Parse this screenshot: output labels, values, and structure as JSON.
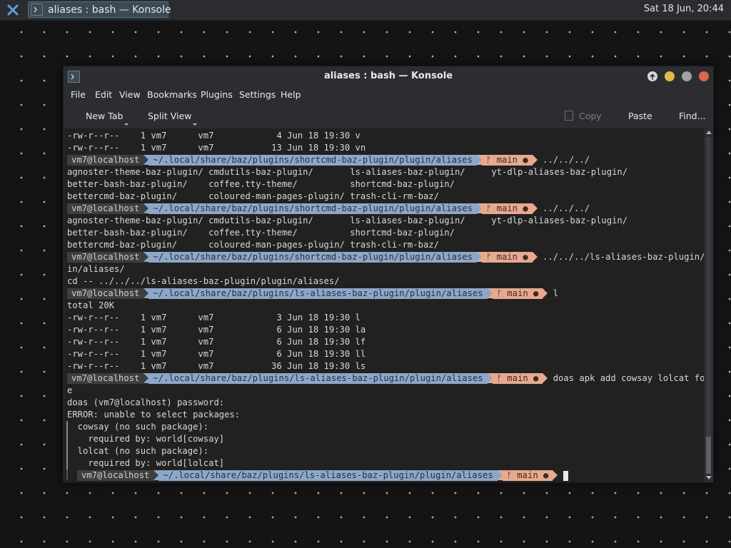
{
  "panel": {
    "task_title": "aliases : bash — Konsole",
    "clock": "Sat 18 Jun, 20:44"
  },
  "window": {
    "title": "aliases : bash — Konsole"
  },
  "menu": [
    "File",
    "Edit",
    "View",
    "Bookmarks",
    "Plugins",
    "Settings",
    "Help"
  ],
  "toolbar": {
    "new_tab": "New Tab",
    "split_view": "Split View",
    "copy": "Copy",
    "paste": "Paste",
    "find": "Find..."
  },
  "prompt": {
    "host": "vm7@localhost",
    "path_shortcmd": "~/.local/share/baz/plugins/shortcmd-baz-plugin/plugin/aliases",
    "path_lsaliases": "~/.local/share/baz/plugins/ls-aliases-baz-plugin/plugin/aliases",
    "git": "ᚠ main ●"
  },
  "terminal": {
    "l0": "-rw-r--r--    1 vm7      vm7            4 Jun 18 19:30 v",
    "l1": "-rw-r--r--    1 vm7      vm7           13 Jun 18 19:30 vn",
    "c2": "../../../",
    "l3": "agnoster-theme-baz-plugin/ cmdutils-baz-plugin/       ls-aliases-baz-plugin/     yt-dlp-aliases-baz-plugin/",
    "l4": "better-bash-baz-plugin/    coffee.tty-theme/          shortcmd-baz-plugin/",
    "l5": "bettercmd-baz-plugin/      coloured-man-pages-plugin/ trash-cli-rm-baz/",
    "c6": "../../../",
    "l7": "agnoster-theme-baz-plugin/ cmdutils-baz-plugin/       ls-aliases-baz-plugin/     yt-dlp-aliases-baz-plugin/",
    "l8": "better-bash-baz-plugin/    coffee.tty-theme/          shortcmd-baz-plugin/",
    "l9": "bettercmd-baz-plugin/      coloured-man-pages-plugin/ trash-cli-rm-baz/",
    "c10": "../../../ls-aliases-baz-plugin/plug",
    "l11": "in/aliases/",
    "l12": "cd -- ../../../ls-aliases-baz-plugin/plugin/aliases/",
    "c13": "l",
    "l14": "total 20K",
    "l15": "-rw-r--r--    1 vm7      vm7            3 Jun 18 19:30 l",
    "l16": "-rw-r--r--    1 vm7      vm7            6 Jun 18 19:30 la",
    "l17": "-rw-r--r--    1 vm7      vm7            6 Jun 18 19:30 lf",
    "l18": "-rw-r--r--    1 vm7      vm7            6 Jun 18 19:30 ll",
    "l19": "-rw-r--r--    1 vm7      vm7           36 Jun 18 19:30 ls",
    "c20": "doas apk add cowsay lolcat fortun",
    "l21": "e",
    "l22": "doas (vm7@localhost) password:",
    "l23": "ERROR: unable to select packages:",
    "l24": "  cowsay (no such package):",
    "l25": "    required by: world[cowsay]",
    "l26": "  lolcat (no such package):",
    "l27": "    required by: world[lolcat]"
  }
}
